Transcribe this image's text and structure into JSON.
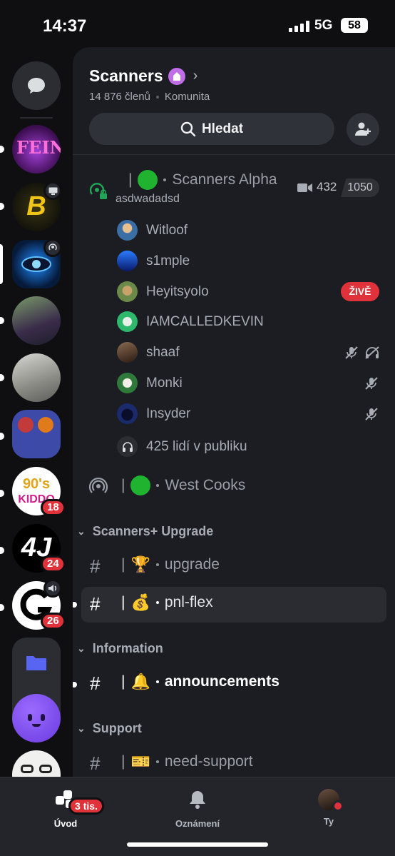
{
  "status_bar": {
    "time": "14:37",
    "network": "5G",
    "battery": "58"
  },
  "rail": {
    "servers": [
      {
        "name": "FEIN",
        "unread": true
      },
      {
        "name": "B",
        "unread": true
      },
      {
        "name": "eye-server",
        "selected": true
      },
      {
        "name": "photo-server",
        "unread": true
      },
      {
        "name": "selfie-server",
        "unread": true
      },
      {
        "name": "server-folder",
        "unread": true
      },
      {
        "name": "90s KIDDO",
        "badge": "18",
        "unread": true
      },
      {
        "name": "4J",
        "badge": "24",
        "unread": true
      },
      {
        "name": "GG",
        "badge": "26",
        "unread": true
      },
      {
        "name": "folder"
      },
      {
        "name": "ghost-server"
      },
      {
        "name": "face-server"
      }
    ]
  },
  "server": {
    "name": "Scanners",
    "members": "14 876 členů",
    "type": "Komunita",
    "search_label": "Hledat"
  },
  "stage": {
    "name": "Scanners Alpha",
    "topic": "asdwadadsd",
    "video_count": "432",
    "capacity": "1050",
    "speakers": [
      {
        "name": "Witloof",
        "live": false,
        "muted": false,
        "deafened": false,
        "color": "#3a6ea5"
      },
      {
        "name": "s1mple",
        "live": false,
        "muted": false,
        "deafened": false,
        "color": "#1e4fd0"
      },
      {
        "name": "Heyitsyolo",
        "live": true,
        "muted": false,
        "deafened": false,
        "color": "#6b8a4a"
      },
      {
        "name": "IAMCALLEDKEVIN",
        "live": false,
        "muted": false,
        "deafened": false,
        "color": "#2db86b"
      },
      {
        "name": "shaaf",
        "live": false,
        "muted": true,
        "deafened": true,
        "color": "#5a4030"
      },
      {
        "name": "Monki",
        "live": false,
        "muted": true,
        "deafened": false,
        "color": "#2f7a3a"
      },
      {
        "name": "Insyder",
        "live": false,
        "muted": true,
        "deafened": false,
        "color": "#1a2a6a"
      }
    ],
    "live_label": "ŽIVĚ",
    "audience": "425 lidí v publiku"
  },
  "west_cooks": {
    "name": "West Cooks"
  },
  "categories": [
    {
      "name": "Scanners+ Upgrade"
    },
    {
      "name": "Information"
    },
    {
      "name": "Support"
    }
  ],
  "channels": {
    "upgrade": {
      "emoji": "🏆",
      "name": "upgrade"
    },
    "pnl_flex": {
      "emoji": "💰",
      "name": "pnl-flex"
    },
    "announcements": {
      "emoji": "🔔",
      "name": "announcements"
    },
    "need_support": {
      "emoji": "🎫",
      "name": "need-support"
    }
  },
  "nav": {
    "home": "Úvod",
    "home_badge": "3 tis.",
    "notifications": "Oznámení",
    "you": "Ty"
  },
  "colors": {
    "accent_red": "#e0323a",
    "green_dot": "#1fb32f",
    "boost": "#c06de8"
  }
}
